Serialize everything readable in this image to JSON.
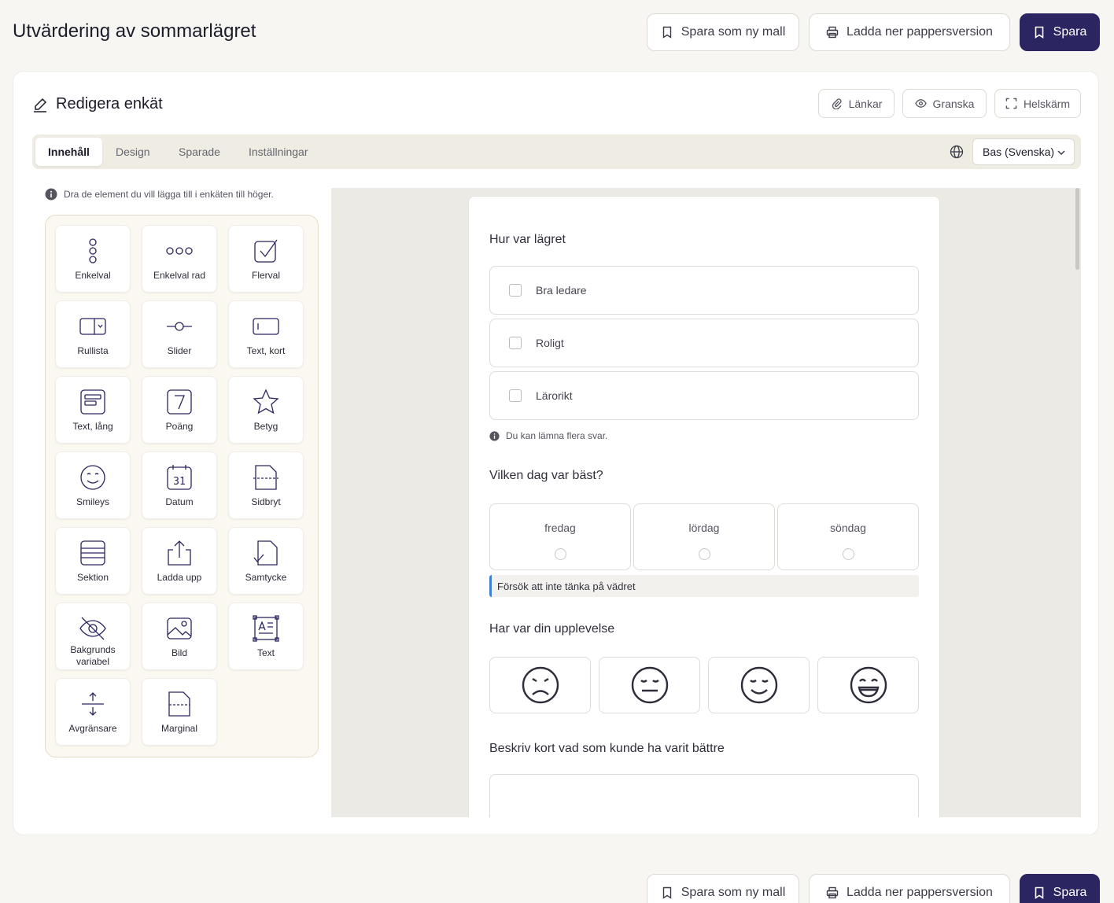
{
  "header": {
    "title": "Utvärdering av sommarlägret",
    "save_template_label": "Spara som ny mall",
    "download_label": "Ladda ner pappersversion",
    "save_label": "Spara"
  },
  "editor": {
    "title": "Redigera enkät",
    "links_label": "Länkar",
    "preview_label": "Granska",
    "fullscreen_label": "Helskärm"
  },
  "tabs": [
    "Innehåll",
    "Design",
    "Sparade",
    "Inställningar"
  ],
  "language": {
    "selected": "Bas (Svenska)"
  },
  "hint": "Dra de element du vill lägga till i enkäten till höger.",
  "palette": [
    {
      "label": "Enkelval",
      "icon": "single-choice-icon"
    },
    {
      "label": "Enkelval rad",
      "icon": "single-choice-row-icon"
    },
    {
      "label": "Flerval",
      "icon": "multiple-choice-icon"
    },
    {
      "label": "Rullista",
      "icon": "dropdown-icon"
    },
    {
      "label": "Slider",
      "icon": "slider-icon"
    },
    {
      "label": "Text, kort",
      "icon": "short-text-icon"
    },
    {
      "label": "Text, lång",
      "icon": "long-text-icon"
    },
    {
      "label": "Poäng",
      "icon": "score-icon"
    },
    {
      "label": "Betyg",
      "icon": "rating-star-icon"
    },
    {
      "label": "Smileys",
      "icon": "smiley-icon"
    },
    {
      "label": "Datum",
      "icon": "calendar-icon"
    },
    {
      "label": "Sidbryt",
      "icon": "page-break-icon"
    },
    {
      "label": "Sektion",
      "icon": "section-icon"
    },
    {
      "label": "Ladda upp",
      "icon": "upload-icon"
    },
    {
      "label": "Samtycke",
      "icon": "consent-icon"
    },
    {
      "label": "Bakgrunds variabel",
      "icon": "hidden-variable-icon"
    },
    {
      "label": "Bild",
      "icon": "image-icon"
    },
    {
      "label": "Text",
      "icon": "text-block-icon"
    },
    {
      "label": "Avgränsare",
      "icon": "divider-icon"
    },
    {
      "label": "Marginal",
      "icon": "margin-icon"
    }
  ],
  "survey": {
    "q1": {
      "title": "Hur var lägret",
      "options": [
        "Bra ledare",
        "Roligt",
        "Lärorikt"
      ],
      "note": "Du kan lämna flera svar."
    },
    "q2": {
      "title": "Vilken dag var bäst?",
      "options": [
        "fredag",
        "lördag",
        "söndag"
      ],
      "callout": "Försök att inte tänka på vädret"
    },
    "q3": {
      "title": "Har var din upplevelse",
      "smileys": [
        "sad-face-icon",
        "neutral-face-icon",
        "content-face-icon",
        "happy-face-icon"
      ]
    },
    "q4": {
      "title": "Beskriv kort vad som kunde ha varit bättre"
    }
  },
  "colors": {
    "primary": "#2b2561",
    "callout_accent": "#3f7fd6",
    "palette_border": "#e4dcc6"
  }
}
